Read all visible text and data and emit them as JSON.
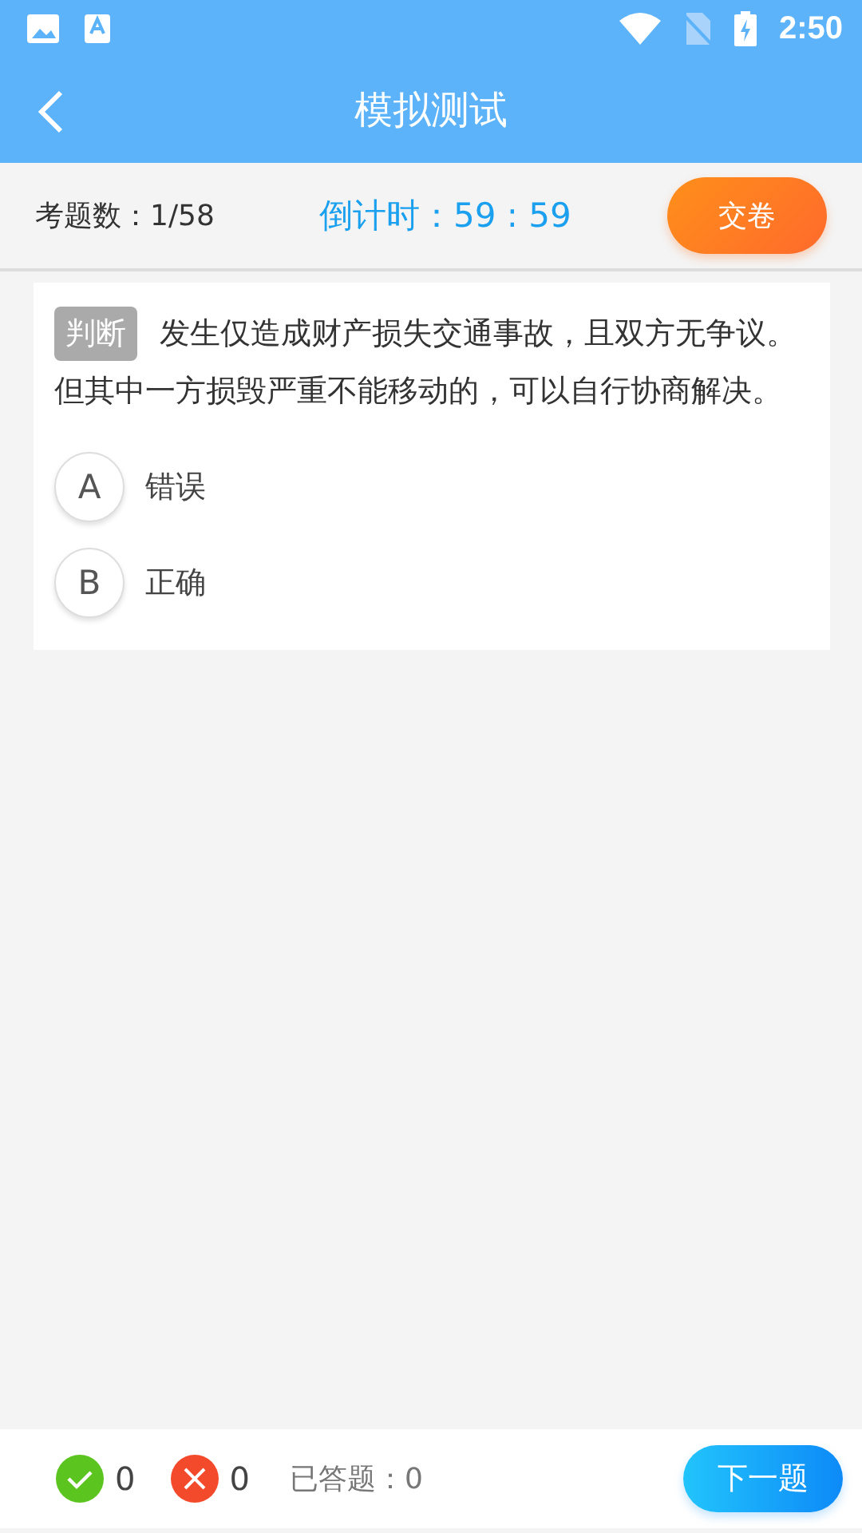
{
  "status_bar": {
    "time": "2:50"
  },
  "header": {
    "title": "模拟测试"
  },
  "info": {
    "count": "考题数：1/58",
    "countdown": "倒计时：59 : 59",
    "submit": "交卷"
  },
  "question": {
    "type": "判断",
    "text": "发生仅造成财产损失交通事故，且双方无争议。但其中一方损毁严重不能移动的，可以自行协商解决。",
    "options": [
      {
        "letter": "A",
        "text": "错误"
      },
      {
        "letter": "B",
        "text": "正确"
      }
    ]
  },
  "footer": {
    "correct": "0",
    "wrong": "0",
    "answered": "已答题：0",
    "next": "下一题"
  }
}
